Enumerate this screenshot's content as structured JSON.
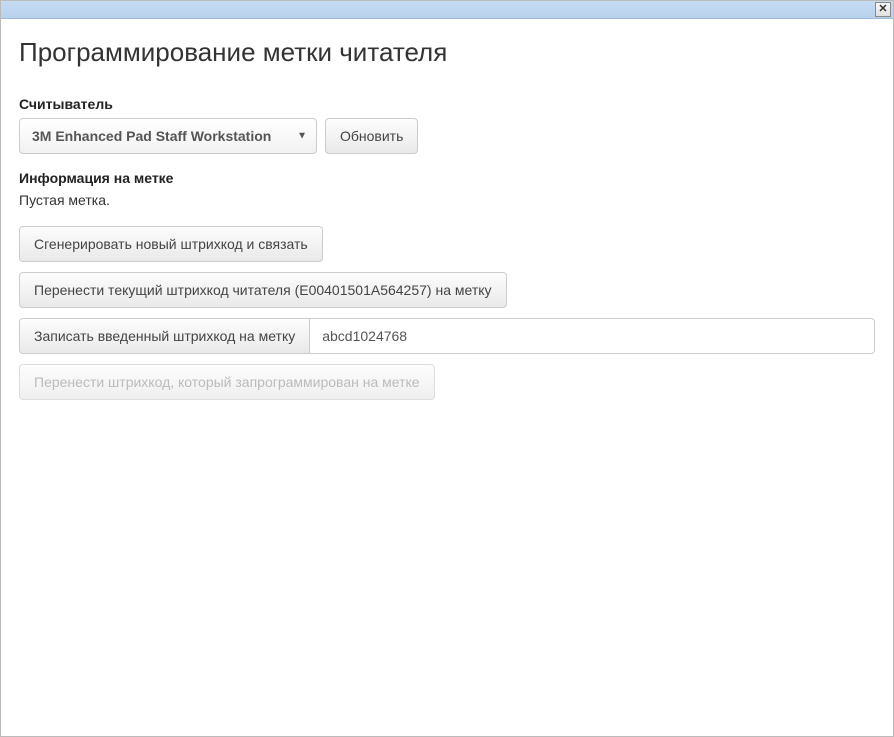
{
  "dialog": {
    "title": "Программирование метки читателя",
    "reader": {
      "label": "Считыватель",
      "selected": "3M Enhanced Pad Staff Workstation",
      "refresh": "Обновить"
    },
    "tag_info": {
      "label": "Информация на метке",
      "status": "Пустая метка."
    },
    "actions": {
      "generate": "Сгенерировать новый штрихкод и связать",
      "transfer_current": "Перенести текущий штрихкод читателя (E00401501A564257) на метку",
      "write_entered": "Записать введенный штрихкод на метку",
      "barcode_value": "abcd1024768",
      "transfer_programmed": "Перенести штрихкод, который запрограммирован на метке"
    }
  }
}
